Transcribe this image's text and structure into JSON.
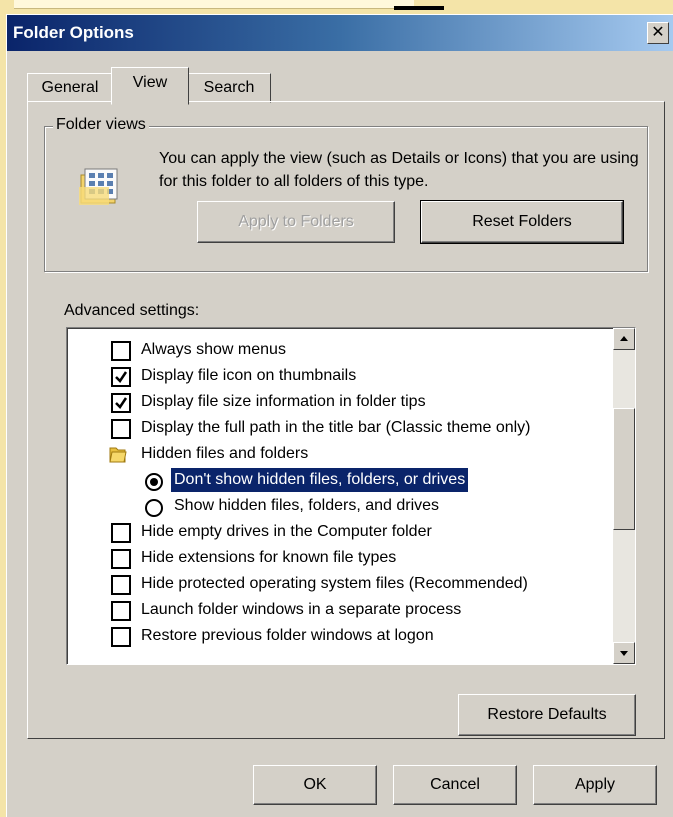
{
  "window": {
    "title": "Folder Options",
    "close_label": "✕"
  },
  "tabs": [
    {
      "label": "General"
    },
    {
      "label": "View"
    },
    {
      "label": "Search"
    }
  ],
  "folder_views": {
    "legend": "Folder views",
    "description": "You can apply the view (such as Details or Icons) that you are using for this folder to all folders of this type.",
    "apply_label": "Apply to Folders",
    "reset_label": "Reset Folders"
  },
  "advanced": {
    "label": "Advanced settings:",
    "items": [
      {
        "kind": "checkbox",
        "checked": false,
        "label": "Always show menus"
      },
      {
        "kind": "checkbox",
        "checked": true,
        "label": "Display file icon on thumbnails"
      },
      {
        "kind": "checkbox",
        "checked": true,
        "label": "Display file size information in folder tips"
      },
      {
        "kind": "checkbox",
        "checked": false,
        "label": "Display the full path in the title bar (Classic theme only)"
      },
      {
        "kind": "folder",
        "label": "Hidden files and folders"
      },
      {
        "kind": "radio",
        "checked": true,
        "selected": true,
        "label": "Don't show hidden files, folders, or drives"
      },
      {
        "kind": "radio",
        "checked": false,
        "label": "Show hidden files, folders, and drives"
      },
      {
        "kind": "checkbox",
        "checked": false,
        "label": "Hide empty drives in the Computer folder"
      },
      {
        "kind": "checkbox",
        "checked": false,
        "label": "Hide extensions for known file types"
      },
      {
        "kind": "checkbox",
        "checked": false,
        "label": "Hide protected operating system files (Recommended)"
      },
      {
        "kind": "checkbox",
        "checked": false,
        "label": "Launch folder windows in a separate process"
      },
      {
        "kind": "checkbox",
        "checked": false,
        "label": "Restore previous folder windows at logon"
      }
    ],
    "restore_label": "Restore Defaults"
  },
  "footer": {
    "ok_label": "OK",
    "cancel_label": "Cancel",
    "apply_label": "Apply"
  },
  "colors": {
    "selection": "#0a246a",
    "face": "#d4d0c8",
    "title_start": "#0a246a"
  }
}
